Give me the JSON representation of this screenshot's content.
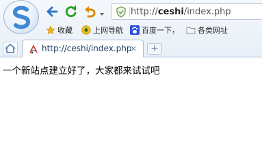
{
  "toolbar": {
    "url_prefix": "http://",
    "url_host": "ceshi",
    "url_path": "/index.php"
  },
  "bookmarks": [
    {
      "label": "收藏",
      "icon": "star-icon"
    },
    {
      "label": "上网导航",
      "icon": "navigation-icon"
    },
    {
      "label": "百度一下，",
      "icon": "baidu-paw-icon"
    },
    {
      "label": "各类网址",
      "icon": "folder-icon"
    }
  ],
  "tab": {
    "title": "http://ceshi/index.php",
    "close_label": "×"
  },
  "newtab_label": "+",
  "page": {
    "text": "一个新站点建立好了，大家都来试试吧"
  },
  "colors": {
    "accent_blue": "#2f77c8",
    "refresh_green": "#2ca02c",
    "undo_orange": "#e08a00"
  }
}
